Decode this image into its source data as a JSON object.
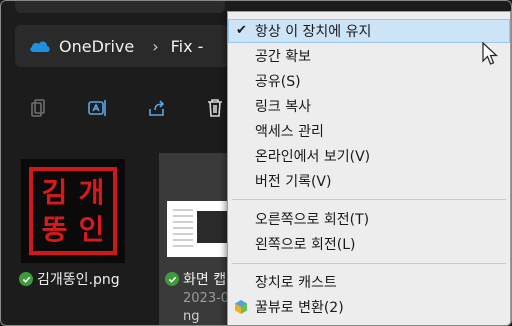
{
  "breadcrumb": {
    "cloud_label": "OneDrive",
    "folder_label": "Fix -"
  },
  "toolbar": {
    "icons": [
      "copy-icon",
      "rename-icon",
      "share-icon",
      "delete-icon"
    ]
  },
  "files": [
    {
      "name": "김개똥인.png",
      "seal_chars": [
        "김",
        "개",
        "똥",
        "인"
      ]
    },
    {
      "name": "화면 캡",
      "date": "2023-0",
      "ext": "ng"
    }
  ],
  "menu": {
    "items": [
      {
        "label": "항상 이 장치에 유지",
        "checked": true,
        "highlighted": true
      },
      {
        "label": "공간 확보"
      },
      {
        "label": "공유(S)"
      },
      {
        "label": "링크 복사"
      },
      {
        "label": "액세스 관리"
      },
      {
        "label": "온라인에서 보기(V)"
      },
      {
        "label": "버전 기록(V)"
      },
      {
        "label": "오른쪽으로 회전(T)"
      },
      {
        "label": "왼쪽으로 회전(L)"
      },
      {
        "label": "장치로 캐스트"
      },
      {
        "label": "꿀뷰로 변환(2)",
        "icon": "honeyview-icon"
      }
    ]
  },
  "colors": {
    "background": "#1b1b1b",
    "menu_bg": "#ededed",
    "menu_highlight": "#cde4f7",
    "sync_check": "#3c9a3c",
    "seal_red": "#d01818",
    "onedrive_blue": "#1e90e0"
  }
}
